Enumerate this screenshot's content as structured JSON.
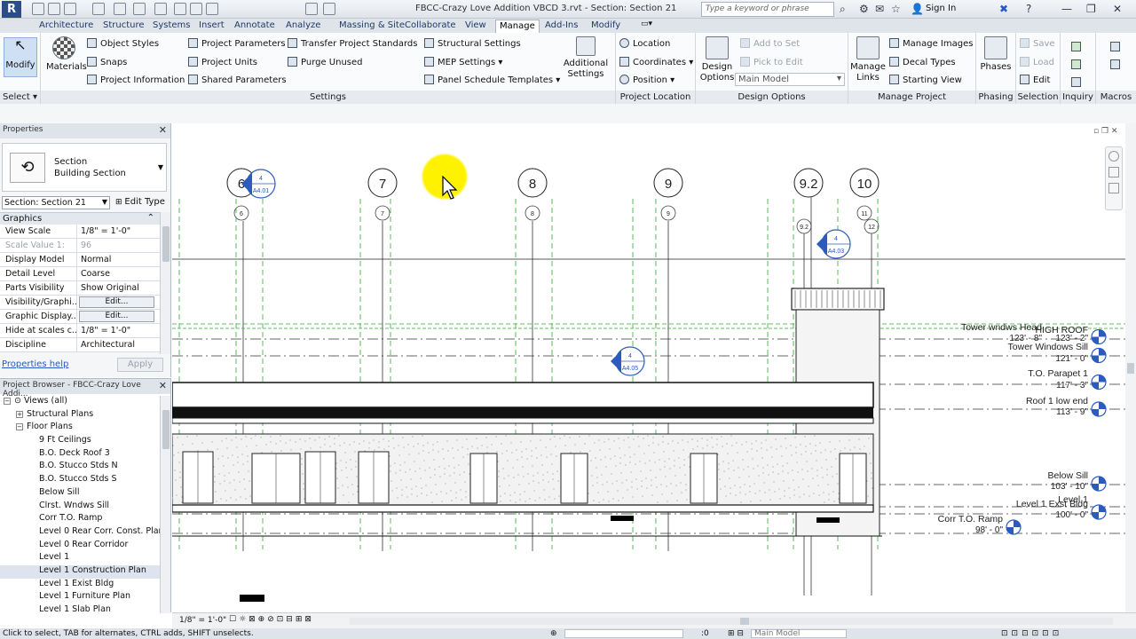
{
  "app": {
    "logo": "R",
    "document_title": "FBCC-Crazy Love Addition VBCD 3.rvt - Section: Section 21",
    "search_placeholder": "Type a keyword or phrase",
    "sign_in": "Sign In"
  },
  "tabs": [
    "Architecture",
    "Structure",
    "Systems",
    "Insert",
    "Annotate",
    "Analyze",
    "Massing & Site",
    "Collaborate",
    "View",
    "Manage",
    "Add-Ins",
    "Modify"
  ],
  "active_tab": "Manage",
  "ribbon": {
    "select": {
      "modify": "Modify",
      "title": "Select ▾"
    },
    "settings": {
      "materials": "Materials",
      "object_styles": "Object Styles",
      "snaps": "Snaps",
      "project_information": "Project Information",
      "project_parameters": "Project Parameters",
      "project_units": "Project Units",
      "shared_parameters": "Shared Parameters",
      "transfer_standards": "Transfer Project Standards",
      "purge_unused": "Purge Unused",
      "structural_settings": "Structural Settings",
      "mep_settings": "MEP Settings ▾",
      "panel_schedule_templates": "Panel Schedule Templates ▾",
      "additional_settings_1": "Additional",
      "additional_settings_2": "Settings",
      "title": "Settings"
    },
    "project_location": {
      "location": "Location",
      "coordinates": "Coordinates ▾",
      "position": "Position ▾",
      "title": "Project Location"
    },
    "design_options": {
      "btn1": "Design",
      "btn2": "Options",
      "add_to_set": "Add to Set",
      "pick_to_edit": "Pick to Edit",
      "main_model": "Main Model",
      "title": "Design Options"
    },
    "manage_project": {
      "manage_links_1": "Manage",
      "manage_links_2": "Links",
      "manage_images": "Manage Images",
      "decal_types": "Decal Types",
      "starting_view": "Starting View",
      "title": "Manage Project"
    },
    "phasing": {
      "phases": "Phases",
      "title": "Phasing"
    },
    "selection": {
      "save": "Save",
      "load": "Load",
      "edit": "Edit",
      "title": "Selection"
    },
    "inquiry": {
      "title": "Inquiry"
    },
    "macros": {
      "title": "Macros"
    }
  },
  "properties": {
    "title": "Properties",
    "type_name": "Section",
    "type_sub": "Building Section",
    "instance_selector": "Section: Section 21",
    "edit_type": "Edit Type",
    "group": "Graphics",
    "rows": [
      {
        "k": "View Scale",
        "v": "1/8\" = 1'-0\""
      },
      {
        "k": "Scale Value    1:",
        "v": "96",
        "dis": true
      },
      {
        "k": "Display Model",
        "v": "Normal"
      },
      {
        "k": "Detail Level",
        "v": "Coarse"
      },
      {
        "k": "Parts Visibility",
        "v": "Show Original"
      },
      {
        "k": "Visibility/Graphi...",
        "v": "Edit...",
        "btn": true
      },
      {
        "k": "Graphic Display...",
        "v": "Edit...",
        "btn": true
      },
      {
        "k": "Hide at scales c...",
        "v": "1/8\" = 1'-0\""
      },
      {
        "k": "Discipline",
        "v": "Architectural"
      }
    ],
    "help": "Properties help",
    "apply": "Apply"
  },
  "project_browser": {
    "title": "Project Browser - FBCC-Crazy Love Addi...",
    "nodes": [
      {
        "t": "Views (all)",
        "lvl": 0,
        "exp": "−"
      },
      {
        "t": "Structural Plans",
        "lvl": 1,
        "exp": "+"
      },
      {
        "t": "Floor Plans",
        "lvl": 1,
        "exp": "−"
      },
      {
        "t": "9 Ft Ceilings",
        "lvl": 2
      },
      {
        "t": "B.O. Deck Roof 3",
        "lvl": 2
      },
      {
        "t": "B.O. Stucco Stds N",
        "lvl": 2
      },
      {
        "t": "B.O. Stucco Stds S",
        "lvl": 2
      },
      {
        "t": "Below Sill",
        "lvl": 2
      },
      {
        "t": "Clrst. Wndws Sill",
        "lvl": 2
      },
      {
        "t": "Corr T.O. Ramp",
        "lvl": 2
      },
      {
        "t": "Level 0 Rear Corr. Const. Plan",
        "lvl": 2
      },
      {
        "t": "Level 0 Rear Corridor",
        "lvl": 2
      },
      {
        "t": "Level 1",
        "lvl": 2
      },
      {
        "t": "Level 1 Construction Plan",
        "lvl": 2,
        "sel": true
      },
      {
        "t": "Level 1 Exist Bldg",
        "lvl": 2
      },
      {
        "t": "Level 1 Furniture Plan",
        "lvl": 2
      },
      {
        "t": "Level 1 Slab Plan",
        "lvl": 2
      }
    ]
  },
  "drawing": {
    "grids": [
      "6",
      "7",
      "8",
      "9",
      "9.2",
      "10"
    ],
    "subgrids": [
      "6",
      "7",
      "8",
      "9",
      "9.2",
      "11",
      "12"
    ],
    "section_tags": [
      "A4.01",
      "A4.03",
      "A4.05"
    ],
    "tag_nums": [
      "4",
      "4",
      "4"
    ],
    "levels": [
      {
        "name": "Tower wndws Head",
        "elev": "123' - 8\""
      },
      {
        "name": "HIGH ROOF",
        "elev": "123' - 2\""
      },
      {
        "name": "Tower Windows Sill",
        "elev": "121' - 0\""
      },
      {
        "name": "T.O. Parapet 1",
        "elev": "117' - 3\""
      },
      {
        "name": "Roof 1 low end",
        "elev": "113' - 9\""
      },
      {
        "name": "Below Sill",
        "elev": "103' - 10\""
      },
      {
        "name": "Level 1",
        "elev": ""
      },
      {
        "name": "Level 1 Exst Bldg",
        "elev": "100' - 0\""
      },
      {
        "name": "Corr T.O. Ramp",
        "elev": "98' - 0\""
      }
    ]
  },
  "view_control": {
    "scale": "1/8\" = 1'-0\""
  },
  "status": {
    "hint": "Click to select, TAB for alternates, CTRL adds, SHIFT unselects.",
    "count": ":0",
    "model": "Main Model"
  }
}
